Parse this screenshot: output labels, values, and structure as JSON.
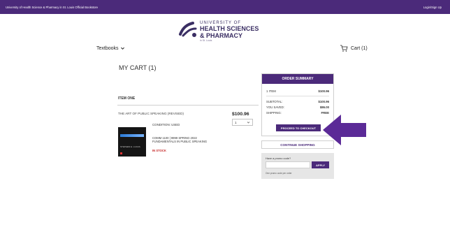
{
  "topbar": {
    "left_text": "University of Health Science & Pharmacy in St. Louis Official Bookstore",
    "right_text": "Login/Sign Up"
  },
  "logo": {
    "line1": "UNIVERSITY OF",
    "line2": "HEALTH SCIENCES",
    "line3": "& PHARMACY",
    "line4": "in St. Louis",
    "mark_color": "#3a2e63"
  },
  "nav": {
    "textbooks_label": "Textbooks",
    "cart_label": "Cart (1)"
  },
  "cart": {
    "heading": "MY CART (1)",
    "item_header": "ITEM ONE",
    "item": {
      "title": "THE ART OF PUBLIC SPEAKING (REVISED)",
      "price": "$100.96",
      "quantity": "1",
      "condition": "CONDITION: USED",
      "course_line1": "COMM 1100 | 9999 SPRING 2022",
      "course_line2": "FUNDAMENTALS IN PUBLIC SPEAKING",
      "stock": "IN STOCK",
      "cover_author": "STEPHEN E. LUCAS"
    }
  },
  "summary": {
    "heading": "ORDER SUMMARY",
    "items_label": "1 ITEM",
    "items_value": "$100.96",
    "subtotal_label": "SUBTOTAL:",
    "subtotal_value": "$100.96",
    "saved_label": "YOU SAVED:",
    "saved_value": "$86.00",
    "shipping_label": "SHIPPING:",
    "shipping_value": "FREE",
    "checkout_label": "PROCEED TO CHECKOUT"
  },
  "continue_label": "CONTINUE SHOPPING",
  "promo": {
    "label": "Have a promo code?",
    "input_value": "",
    "apply_label": "APPLY",
    "note": "One promo code per order"
  },
  "colors": {
    "brand": "#4b2a7a",
    "accent_arrow": "#5b2a97",
    "stock_red": "#c62828"
  }
}
